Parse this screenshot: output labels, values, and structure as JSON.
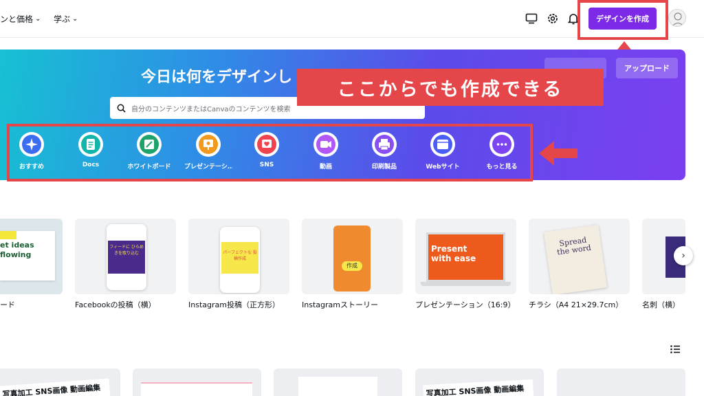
{
  "nav": {
    "pricing": "ンと価格",
    "learn": "学ぶ",
    "create_button": "デザインを作成",
    "icons": [
      "monitor-icon",
      "gear-icon",
      "bell-icon",
      "chevron-down-icon"
    ]
  },
  "hero": {
    "title": "今日は何をデザインし",
    "upload_button": "アップロード",
    "search_placeholder": "自分のコンテンツまたはCanvaのコンテンツを検索",
    "categories": [
      {
        "label": "おすすめ",
        "icon": "sparkle-icon",
        "color": "#3a6df0"
      },
      {
        "label": "Docs",
        "icon": "docs-icon",
        "color": "#12b5a9"
      },
      {
        "label": "ホワイトボード",
        "icon": "whiteboard-icon",
        "color": "#1ea36b"
      },
      {
        "label": "プレゼンテーシ…",
        "icon": "presentation-icon",
        "color": "#f29a1d"
      },
      {
        "label": "SNS",
        "icon": "heart-icon",
        "color": "#f0434f"
      },
      {
        "label": "動画",
        "icon": "video-icon",
        "color": "#b257f5"
      },
      {
        "label": "印刷製品",
        "icon": "printer-icon",
        "color": "#8a4ff2"
      },
      {
        "label": "Webサイト",
        "icon": "website-icon",
        "color": "#4a5df5"
      },
      {
        "label": "もっと見る",
        "icon": "more-icon",
        "color": "#7d45f1"
      }
    ]
  },
  "annotation": {
    "callout": "ここからでも作成できる",
    "accent": "#e5464a"
  },
  "templates": [
    {
      "label": "ード",
      "thumb_text": "et ideas flowing"
    },
    {
      "label": "Facebookの投稿（横）",
      "thumb_text": "フィードに ひらめきを取り込む"
    },
    {
      "label": "Instagram投稿（正方形）",
      "thumb_text": "パーフェクトな 投稿作成"
    },
    {
      "label": "Instagramストーリー",
      "thumb_text": "作成"
    },
    {
      "label": "プレゼンテーション（16:9）",
      "thumb_text": "Present with ease"
    },
    {
      "label": "チラシ（A4 21×29.7cm）",
      "thumb_text": "Spread the word"
    },
    {
      "label": "名刺（横）",
      "thumb_text": ""
    }
  ],
  "bottom_cards": [
    {
      "text": "写真加工 SNS画像 動画編集"
    },
    {
      "text": ""
    },
    {
      "text": ""
    },
    {
      "text": "写真加工 SNS画像 動画編集"
    },
    {
      "text": ""
    }
  ]
}
